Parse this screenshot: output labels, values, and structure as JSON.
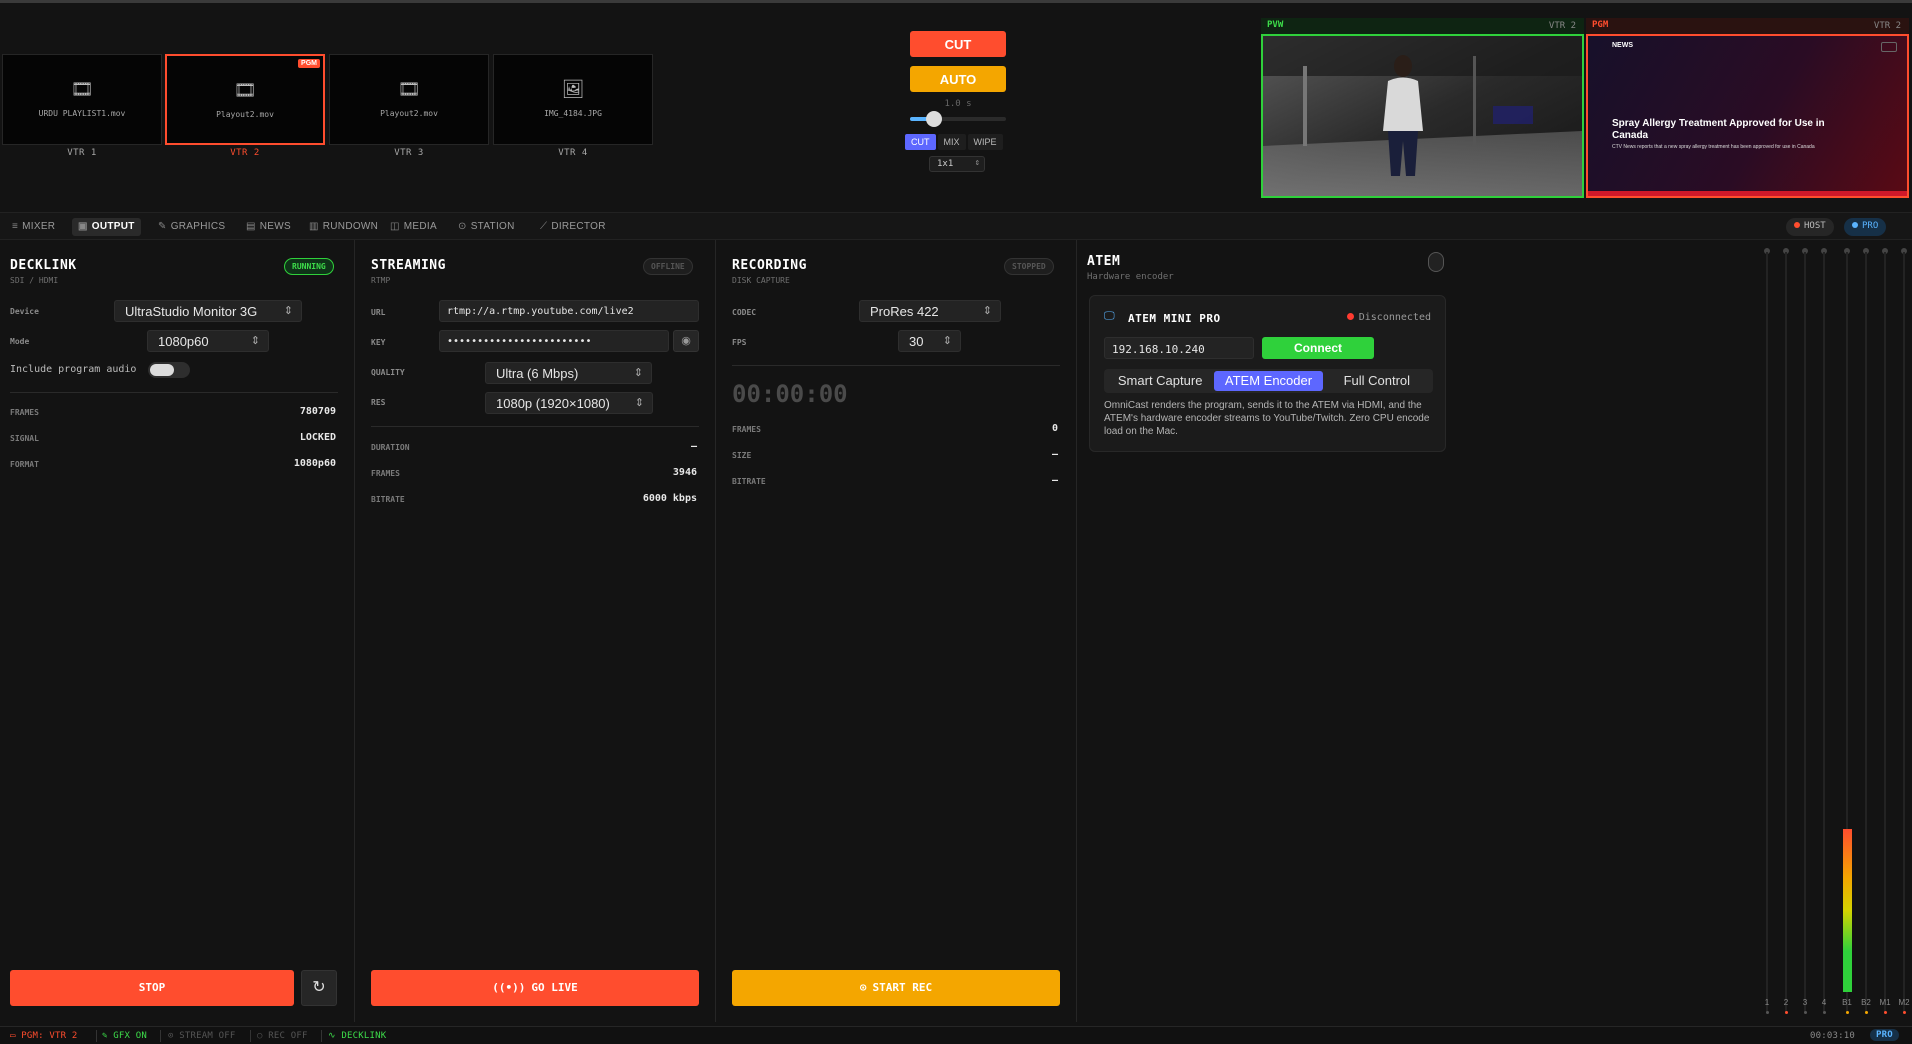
{
  "vtrs": [
    {
      "label": "VTR 1",
      "source": "URDU PLAYLIST1.mov",
      "icon": "film-icon"
    },
    {
      "label": "VTR 2",
      "source": "Playout2.mov",
      "icon": "film-icon",
      "badge": "PGM"
    },
    {
      "label": "VTR 3",
      "source": "Playout2.mov",
      "icon": "film-icon"
    },
    {
      "label": "VTR 4",
      "source": "IMG_4184.JPG",
      "icon": "image-icon"
    }
  ],
  "transition": {
    "cut_label": "CUT",
    "auto_label": "AUTO",
    "duration": "1.0 s",
    "position": 0.25,
    "types": [
      "CUT",
      "MIX",
      "WIPE"
    ],
    "active_type": "CUT",
    "grid_value": "1x1"
  },
  "monitors": {
    "pvw": {
      "label": "PVW",
      "source": "VTR 2"
    },
    "pgm": {
      "label": "PGM",
      "source": "VTR 2",
      "brand": "NEWS",
      "headline": "Spray Allergy Treatment Approved for Use in Canada",
      "subline": "CTV News reports that a new spray allergy treatment has been approved for use in Canada"
    }
  },
  "tabs": [
    {
      "label": "MIXER",
      "icon": "menu-icon"
    },
    {
      "label": "OUTPUT",
      "icon": "camera-icon",
      "active": true
    },
    {
      "label": "GRAPHICS",
      "icon": "brush-icon"
    },
    {
      "label": "NEWS",
      "icon": "newspaper-icon"
    },
    {
      "label": "RUNDOWN",
      "icon": "clipboard-icon"
    },
    {
      "label": "MEDIA",
      "icon": "database-icon"
    },
    {
      "label": "STATION",
      "icon": "antenna-icon"
    },
    {
      "label": "DIRECTOR",
      "icon": "wand-icon"
    }
  ],
  "header_pills": {
    "host": "HOST",
    "pro": "PRO"
  },
  "decklink": {
    "title": "DECKLINK",
    "subtitle": "SDI / HDMI",
    "status": "RUNNING",
    "device_label": "Device",
    "device": "UltraStudio Monitor 3G",
    "mode_label": "Mode",
    "mode": "1080p60",
    "audio_label": "Include program audio",
    "audio_on": false,
    "stats": [
      {
        "label": "FRAMES",
        "value": "780709"
      },
      {
        "label": "SIGNAL",
        "value": "LOCKED"
      },
      {
        "label": "FORMAT",
        "value": "1080p60"
      }
    ],
    "stop_label": "STOP"
  },
  "streaming": {
    "title": "STREAMING",
    "subtitle": "RTMP",
    "status": "OFFLINE",
    "url_label": "URL",
    "url": "rtmp://a.rtmp.youtube.com/live2",
    "key_label": "KEY",
    "key_masked": "••••••••••••••••••••••••",
    "quality_label": "QUALITY",
    "quality": "Ultra (6 Mbps)",
    "res_label": "RES",
    "res": "1080p (1920×1080)",
    "stats": [
      {
        "label": "DURATION",
        "value": "—"
      },
      {
        "label": "FRAMES",
        "value": "3946"
      },
      {
        "label": "BITRATE",
        "value": "6000 kbps"
      }
    ],
    "go_label": "GO LIVE"
  },
  "recording": {
    "title": "RECORDING",
    "subtitle": "DISK CAPTURE",
    "status": "STOPPED",
    "codec_label": "CODEC",
    "codec": "ProRes 422",
    "fps_label": "FPS",
    "fps": "30",
    "timer": "00:00:00",
    "stats": [
      {
        "label": "FRAMES",
        "value": "0"
      },
      {
        "label": "SIZE",
        "value": "—"
      },
      {
        "label": "BITRATE",
        "value": "—"
      }
    ],
    "rec_label": "START REC"
  },
  "atem": {
    "title": "ATEM",
    "subtitle": "Hardware encoder",
    "device": "ATEM MINI PRO",
    "conn_status": "Disconnected",
    "ip": "192.168.10.240",
    "connect_label": "Connect",
    "modes": [
      "Smart Capture",
      "ATEM Encoder",
      "Full Control"
    ],
    "active_mode": "ATEM Encoder",
    "description": "OmniCast renders the program, sends it to the ATEM via HDMI, and the ATEM's hardware encoder streams to YouTube/Twitch. Zero CPU encode load on the Mac."
  },
  "meters": {
    "channels": [
      "1",
      "2",
      "3",
      "4",
      "B1",
      "B2",
      "M1",
      "M2"
    ],
    "levels": [
      0,
      0,
      0,
      0,
      0.22,
      0,
      0,
      0
    ]
  },
  "statusbar": {
    "pgm": "PGM: VTR 2",
    "gfx": "GFX ON",
    "stream": "STREAM OFF",
    "rec": "REC OFF",
    "decklink": "DECKLINK",
    "timecode": "00:03:10",
    "pro": "PRO"
  },
  "colors": {
    "accent_red": "#ff4d2e",
    "accent_orange": "#f4a600",
    "accent_green": "#2fd13b",
    "accent_blue": "#5d67ff",
    "background": "#131313"
  }
}
